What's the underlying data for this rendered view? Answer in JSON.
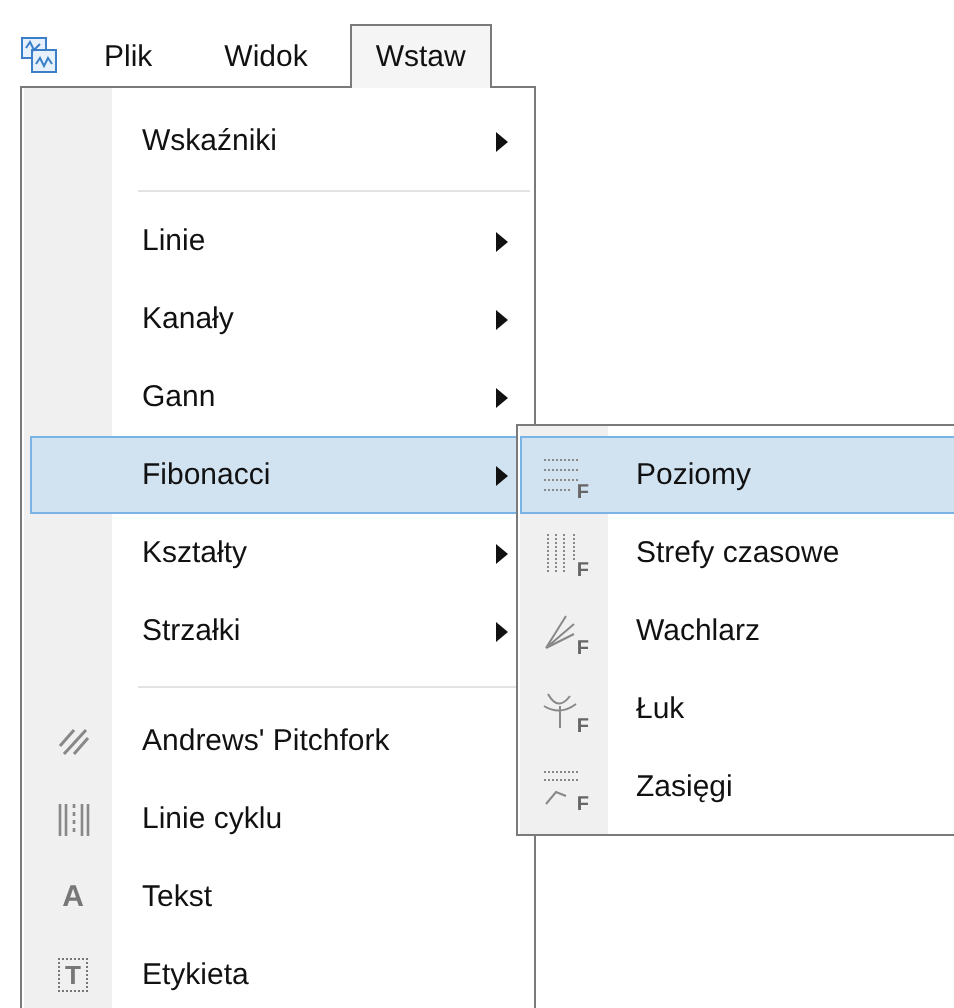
{
  "menubar": {
    "items": [
      {
        "label": "Plik",
        "selected": false
      },
      {
        "label": "Widok",
        "selected": false
      },
      {
        "label": "Wstaw",
        "selected": true
      }
    ]
  },
  "menu": {
    "items": [
      {
        "kind": "submenu",
        "label": "Wskaźniki",
        "selected": false
      },
      {
        "kind": "separator"
      },
      {
        "kind": "submenu",
        "label": "Linie",
        "selected": false
      },
      {
        "kind": "submenu",
        "label": "Kanały",
        "selected": false
      },
      {
        "kind": "submenu",
        "label": "Gann",
        "selected": false
      },
      {
        "kind": "submenu",
        "label": "Fibonacci",
        "selected": true,
        "expanded": true,
        "children": [
          {
            "label": "Poziomy",
            "glyph": "F",
            "selected": true
          },
          {
            "label": "Strefy czasowe",
            "glyph": "F",
            "selected": false
          },
          {
            "label": "Wachlarz",
            "glyph": "F",
            "selected": false
          },
          {
            "label": "Łuk",
            "glyph": "F",
            "selected": false
          },
          {
            "label": "Zasięgi",
            "glyph": "F",
            "selected": false
          }
        ]
      },
      {
        "kind": "submenu",
        "label": "Kształty",
        "selected": false
      },
      {
        "kind": "submenu",
        "label": "Strzałki",
        "selected": false
      },
      {
        "kind": "separator"
      },
      {
        "kind": "tool",
        "label": "Andrews' Pitchfork",
        "selected": false
      },
      {
        "kind": "tool",
        "label": "Linie cyklu",
        "selected": false
      },
      {
        "kind": "tool",
        "label": "Tekst",
        "glyph": "A",
        "selected": false
      },
      {
        "kind": "tool",
        "label": "Etykieta",
        "glyph": "T",
        "selected": false
      }
    ]
  }
}
